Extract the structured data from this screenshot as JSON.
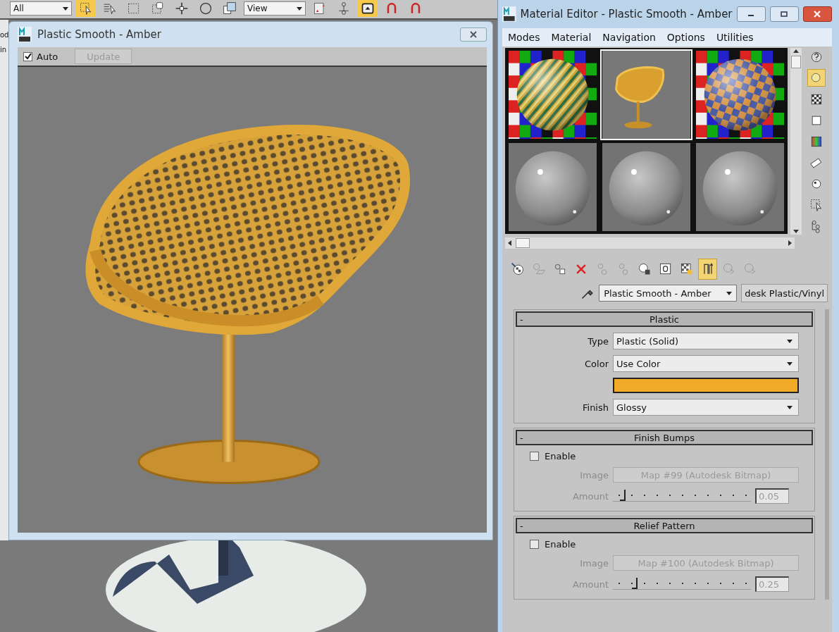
{
  "main_toolbar": {
    "items": [
      {
        "kind": "dropdown",
        "value": "All"
      },
      {
        "kind": "select",
        "on": true
      },
      {
        "kind": "select-by-name",
        "on": false
      },
      {
        "kind": "region",
        "on": false
      },
      {
        "kind": "crossing",
        "on": false
      },
      {
        "kind": "move",
        "on": false
      },
      {
        "kind": "circle",
        "on": false
      },
      {
        "kind": "scale",
        "on": false
      },
      {
        "kind": "dropdown",
        "value": "View"
      },
      {
        "kind": "pivot",
        "on": false
      },
      {
        "kind": "link",
        "on": false
      },
      {
        "kind": "toggle",
        "on": true
      },
      {
        "kind": "magnet",
        "on": false
      },
      {
        "kind": "magnet",
        "on": false
      }
    ]
  },
  "side_fragments": [
    "od",
    "in"
  ],
  "render_window": {
    "title": "Plastic Smooth - Amber",
    "auto": {
      "label": "Auto",
      "checked": true
    },
    "update": {
      "label": "Update",
      "disabled": true
    }
  },
  "material_editor": {
    "title": "Material Editor - Plastic Smooth - Amber",
    "menu": [
      "Modes",
      "Material",
      "Navigation",
      "Options",
      "Utilities"
    ],
    "slots": [
      {
        "kind": "checker-sphere",
        "selected": false
      },
      {
        "kind": "chair",
        "selected": true
      },
      {
        "kind": "blue-orange-sphere",
        "selected": false
      },
      {
        "kind": "grey-sphere",
        "selected": false
      },
      {
        "kind": "grey-sphere",
        "selected": false
      },
      {
        "kind": "grey-sphere",
        "selected": false
      }
    ],
    "side_tools": [
      {
        "kind": "sample-type",
        "on": false
      },
      {
        "kind": "backlight",
        "on": true
      },
      {
        "kind": "checker",
        "on": false
      },
      {
        "kind": "uv",
        "on": false
      },
      {
        "kind": "video",
        "on": false
      },
      {
        "kind": "preview",
        "on": false
      },
      {
        "kind": "options",
        "on": false
      },
      {
        "kind": "select",
        "on": false
      },
      {
        "kind": "navigator",
        "on": false
      }
    ],
    "tools": [
      {
        "kind": "get",
        "disabled": false,
        "on": false
      },
      {
        "kind": "put",
        "disabled": true,
        "on": false
      },
      {
        "kind": "assign",
        "disabled": false,
        "on": false
      },
      {
        "kind": "delete",
        "disabled": false,
        "on": false
      },
      {
        "kind": "copy",
        "disabled": true,
        "on": false
      },
      {
        "kind": "unique",
        "disabled": true,
        "on": false
      },
      {
        "kind": "library",
        "disabled": false,
        "on": false
      },
      {
        "kind": "channel",
        "disabled": false,
        "on": false
      },
      {
        "kind": "map",
        "disabled": false,
        "on": false
      },
      {
        "kind": "end-result",
        "disabled": false,
        "on": true
      },
      {
        "kind": "up",
        "disabled": true,
        "on": false
      },
      {
        "kind": "sideways",
        "disabled": true,
        "on": false
      }
    ],
    "material_name": "Plastic Smooth - Amber",
    "material_type": "desk Plastic/Vinyl",
    "rollouts": [
      {
        "toggle": "-",
        "title": "Plastic",
        "fields": [
          {
            "kind": "dropdown",
            "label": "Type",
            "value": "Plastic (Solid)"
          },
          {
            "kind": "dropdown",
            "label": "Color",
            "value": "Use Color"
          },
          {
            "kind": "swatch",
            "color": "#f0aa28"
          },
          {
            "kind": "dropdown",
            "label": "Finish",
            "value": "Glossy"
          }
        ]
      },
      {
        "toggle": "-",
        "title": "Finish Bumps",
        "fields": [
          {
            "kind": "checkbox",
            "label": "Enable",
            "checked": false
          },
          {
            "kind": "map",
            "label": "Image",
            "value": "Map #99 (Autodesk Bitmap)",
            "disabled": true
          },
          {
            "kind": "slider",
            "label": "Amount",
            "level": 0.05,
            "reading": "0.05",
            "disabled": true
          }
        ]
      },
      {
        "toggle": "-",
        "title": "Relief Pattern",
        "fields": [
          {
            "kind": "checkbox",
            "label": "Enable",
            "checked": false
          },
          {
            "kind": "map",
            "label": "Image",
            "value": "Map #100 (Autodesk Bitmap)",
            "disabled": true
          },
          {
            "kind": "slider",
            "label": "Amount",
            "level": 0.14,
            "reading": "0.25",
            "disabled": true
          }
        ]
      }
    ]
  }
}
